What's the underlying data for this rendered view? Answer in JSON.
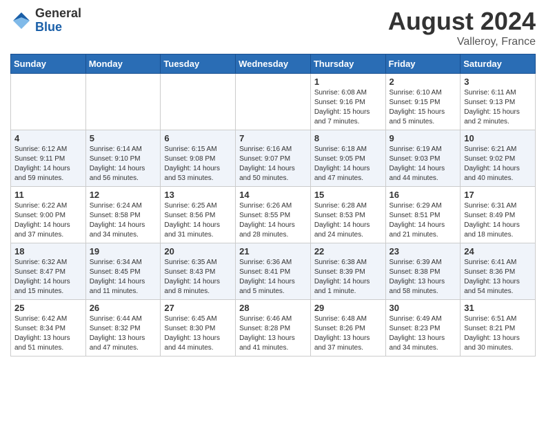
{
  "header": {
    "logo_general": "General",
    "logo_blue": "Blue",
    "month": "August 2024",
    "location": "Valleroy, France"
  },
  "weekdays": [
    "Sunday",
    "Monday",
    "Tuesday",
    "Wednesday",
    "Thursday",
    "Friday",
    "Saturday"
  ],
  "weeks": [
    [
      {
        "day": "",
        "info": ""
      },
      {
        "day": "",
        "info": ""
      },
      {
        "day": "",
        "info": ""
      },
      {
        "day": "",
        "info": ""
      },
      {
        "day": "1",
        "info": "Sunrise: 6:08 AM\nSunset: 9:16 PM\nDaylight: 15 hours\nand 7 minutes."
      },
      {
        "day": "2",
        "info": "Sunrise: 6:10 AM\nSunset: 9:15 PM\nDaylight: 15 hours\nand 5 minutes."
      },
      {
        "day": "3",
        "info": "Sunrise: 6:11 AM\nSunset: 9:13 PM\nDaylight: 15 hours\nand 2 minutes."
      }
    ],
    [
      {
        "day": "4",
        "info": "Sunrise: 6:12 AM\nSunset: 9:11 PM\nDaylight: 14 hours\nand 59 minutes."
      },
      {
        "day": "5",
        "info": "Sunrise: 6:14 AM\nSunset: 9:10 PM\nDaylight: 14 hours\nand 56 minutes."
      },
      {
        "day": "6",
        "info": "Sunrise: 6:15 AM\nSunset: 9:08 PM\nDaylight: 14 hours\nand 53 minutes."
      },
      {
        "day": "7",
        "info": "Sunrise: 6:16 AM\nSunset: 9:07 PM\nDaylight: 14 hours\nand 50 minutes."
      },
      {
        "day": "8",
        "info": "Sunrise: 6:18 AM\nSunset: 9:05 PM\nDaylight: 14 hours\nand 47 minutes."
      },
      {
        "day": "9",
        "info": "Sunrise: 6:19 AM\nSunset: 9:03 PM\nDaylight: 14 hours\nand 44 minutes."
      },
      {
        "day": "10",
        "info": "Sunrise: 6:21 AM\nSunset: 9:02 PM\nDaylight: 14 hours\nand 40 minutes."
      }
    ],
    [
      {
        "day": "11",
        "info": "Sunrise: 6:22 AM\nSunset: 9:00 PM\nDaylight: 14 hours\nand 37 minutes."
      },
      {
        "day": "12",
        "info": "Sunrise: 6:24 AM\nSunset: 8:58 PM\nDaylight: 14 hours\nand 34 minutes."
      },
      {
        "day": "13",
        "info": "Sunrise: 6:25 AM\nSunset: 8:56 PM\nDaylight: 14 hours\nand 31 minutes."
      },
      {
        "day": "14",
        "info": "Sunrise: 6:26 AM\nSunset: 8:55 PM\nDaylight: 14 hours\nand 28 minutes."
      },
      {
        "day": "15",
        "info": "Sunrise: 6:28 AM\nSunset: 8:53 PM\nDaylight: 14 hours\nand 24 minutes."
      },
      {
        "day": "16",
        "info": "Sunrise: 6:29 AM\nSunset: 8:51 PM\nDaylight: 14 hours\nand 21 minutes."
      },
      {
        "day": "17",
        "info": "Sunrise: 6:31 AM\nSunset: 8:49 PM\nDaylight: 14 hours\nand 18 minutes."
      }
    ],
    [
      {
        "day": "18",
        "info": "Sunrise: 6:32 AM\nSunset: 8:47 PM\nDaylight: 14 hours\nand 15 minutes."
      },
      {
        "day": "19",
        "info": "Sunrise: 6:34 AM\nSunset: 8:45 PM\nDaylight: 14 hours\nand 11 minutes."
      },
      {
        "day": "20",
        "info": "Sunrise: 6:35 AM\nSunset: 8:43 PM\nDaylight: 14 hours\nand 8 minutes."
      },
      {
        "day": "21",
        "info": "Sunrise: 6:36 AM\nSunset: 8:41 PM\nDaylight: 14 hours\nand 5 minutes."
      },
      {
        "day": "22",
        "info": "Sunrise: 6:38 AM\nSunset: 8:39 PM\nDaylight: 14 hours\nand 1 minute."
      },
      {
        "day": "23",
        "info": "Sunrise: 6:39 AM\nSunset: 8:38 PM\nDaylight: 13 hours\nand 58 minutes."
      },
      {
        "day": "24",
        "info": "Sunrise: 6:41 AM\nSunset: 8:36 PM\nDaylight: 13 hours\nand 54 minutes."
      }
    ],
    [
      {
        "day": "25",
        "info": "Sunrise: 6:42 AM\nSunset: 8:34 PM\nDaylight: 13 hours\nand 51 minutes."
      },
      {
        "day": "26",
        "info": "Sunrise: 6:44 AM\nSunset: 8:32 PM\nDaylight: 13 hours\nand 47 minutes."
      },
      {
        "day": "27",
        "info": "Sunrise: 6:45 AM\nSunset: 8:30 PM\nDaylight: 13 hours\nand 44 minutes."
      },
      {
        "day": "28",
        "info": "Sunrise: 6:46 AM\nSunset: 8:28 PM\nDaylight: 13 hours\nand 41 minutes."
      },
      {
        "day": "29",
        "info": "Sunrise: 6:48 AM\nSunset: 8:26 PM\nDaylight: 13 hours\nand 37 minutes."
      },
      {
        "day": "30",
        "info": "Sunrise: 6:49 AM\nSunset: 8:23 PM\nDaylight: 13 hours\nand 34 minutes."
      },
      {
        "day": "31",
        "info": "Sunrise: 6:51 AM\nSunset: 8:21 PM\nDaylight: 13 hours\nand 30 minutes."
      }
    ]
  ]
}
